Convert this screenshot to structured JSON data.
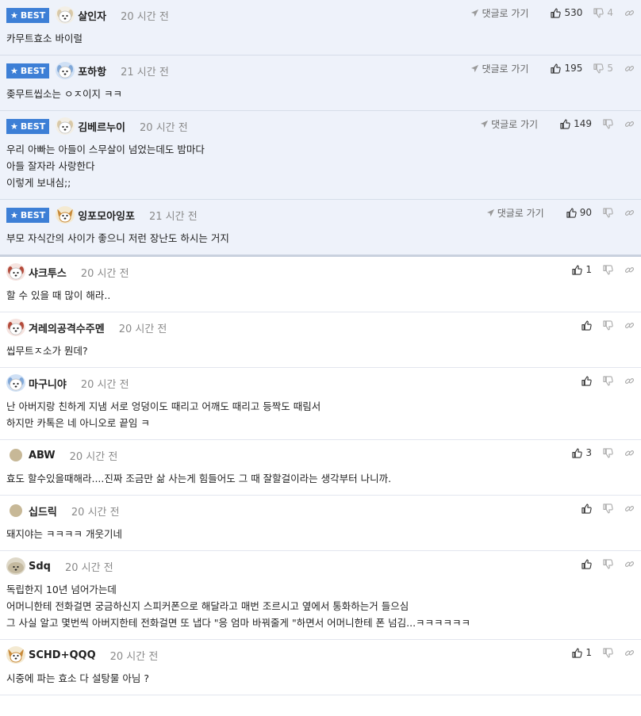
{
  "goto_label": "댓글로 가기",
  "best_label": "BEST",
  "colors": {
    "best_bg": "#eef2fa",
    "badge": "#3d7fd6"
  },
  "comments": [
    {
      "best": true,
      "avatar": "dog-white",
      "name": "살인자",
      "time": "20 시간 전",
      "text": "카무트효소 바이럴",
      "up": "530",
      "down": "4"
    },
    {
      "best": true,
      "avatar": "dog-blue",
      "name": "포하항",
      "time": "21 시간 전",
      "text": "좆무트씹소는 ㅇㅈ이지 ㅋㅋ",
      "up": "195",
      "down": "5"
    },
    {
      "best": true,
      "avatar": "dog-white",
      "name": "김베르누이",
      "time": "20 시간 전",
      "text": "우리 아빠는 아들이 스무살이 넘었는데도 밤마다\n아들 잘자라 사랑한다\n이렇게 보내심;;",
      "up": "149",
      "down": ""
    },
    {
      "best": true,
      "avatar": "dog-fennec",
      "name": "잉포모아잉포",
      "time": "21 시간 전",
      "text": "부모 자식간의 사이가 좋으니 저런 장난도 하시는 거지",
      "up": "90",
      "down": ""
    },
    {
      "best": false,
      "avatar": "dog-red",
      "name": "샤크투스",
      "time": "20 시간 전",
      "text": "할 수 있을 때 많이 해라..",
      "up": "1",
      "down": ""
    },
    {
      "best": false,
      "avatar": "dog-red",
      "name": "겨레의공격수주멘",
      "time": "20 시간 전",
      "text": "씹무트ㅈ소가 뭔데?",
      "up": "",
      "down": ""
    },
    {
      "best": false,
      "avatar": "dog-blue",
      "name": "마구니야",
      "time": "20 시간 전",
      "text": "난 아버지랑 친하게 지냄 서로 엉덩이도 때리고 어깨도 때리고 등짝도 때림서\n하지만 카톡은 네 아니오로 끝임 ㅋ",
      "up": "",
      "down": ""
    },
    {
      "best": false,
      "avatar": "dot",
      "name": "ABW",
      "time": "20 시간 전",
      "text": "효도 할수있을때해라....진짜 조금만 삶 사는게 힘들어도 그 때 잘할걸이라는 생각부터 나니까.",
      "up": "3",
      "down": ""
    },
    {
      "best": false,
      "avatar": "dot",
      "name": "십드릭",
      "time": "20 시간 전",
      "text": "돼지야는 ㅋㅋㅋㅋ 개웃기네",
      "up": "",
      "down": ""
    },
    {
      "best": false,
      "avatar": "seal",
      "name": "Sdq",
      "time": "20 시간 전",
      "text": "독립한지 10년 넘어가는데\n어머니한테 전화걸면 궁금하신지 스피커폰으로 해달라고 매번 조르시고 옆에서 통화하는거 들으심\n그 사실 알고 몇번씩 아버지한테 전화걸면 또 냅다 \"응 엄마 바꿔줄게 \"하면서 어머니한테 폰 넘김...ㅋㅋㅋㅋㅋㅋ",
      "up": "",
      "down": ""
    },
    {
      "best": false,
      "avatar": "dog-fennec",
      "name": "SCHD+QQQ",
      "time": "20 시간 전",
      "text": "시중에 파는 효소 다 설탕물 아님 ?",
      "up": "1",
      "down": ""
    }
  ]
}
